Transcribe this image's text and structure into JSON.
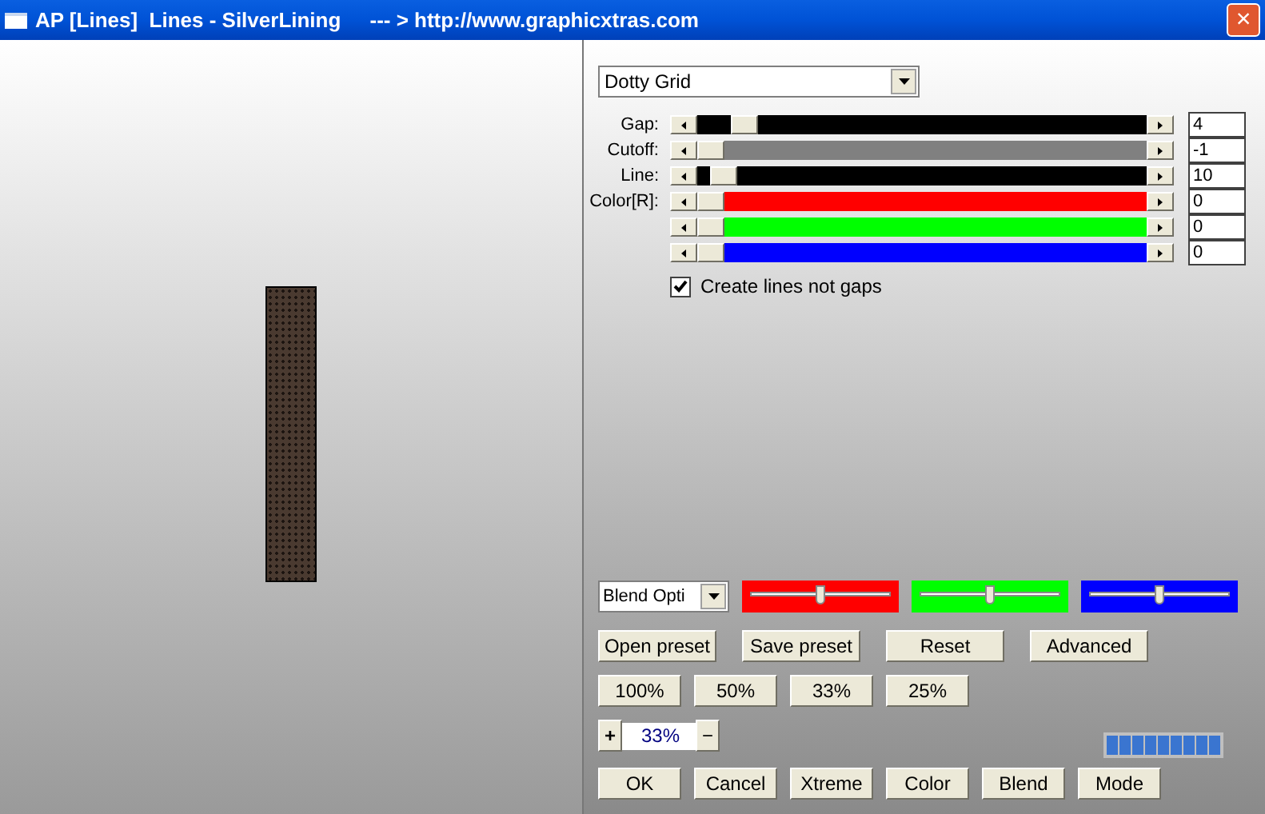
{
  "window": {
    "title": "AP [Lines]  Lines - SilverLining     --- > http://www.graphicxtras.com",
    "close": "×"
  },
  "preset_select": {
    "value": "Dotty Grid"
  },
  "sliders": [
    {
      "label": "Gap:",
      "color": "#000000",
      "level": 0.08,
      "value": "4"
    },
    {
      "label": "Cutoff:",
      "color": "#808080",
      "level": 0,
      "value": "-1"
    },
    {
      "label": "Line:",
      "color": "#000000",
      "level": 0.03,
      "value": "10"
    },
    {
      "label": "Color[R]:",
      "color": "#ff0000",
      "level": 0,
      "value": "0"
    },
    {
      "color": "#00ff00",
      "level": 0,
      "value": "0"
    },
    {
      "color": "#0000ff",
      "level": 0,
      "value": "0"
    }
  ],
  "checkbox": {
    "label": "Create lines not gaps",
    "checked": true
  },
  "blend_select": {
    "value": "Blend Opti"
  },
  "blend_sliders": [
    {
      "color": "#ff0000",
      "level": 0.5
    },
    {
      "color": "#00ff00",
      "level": 0.5
    },
    {
      "color": "#0000ff",
      "level": 0.5
    }
  ],
  "preset_buttons": [
    "Open preset",
    "Save preset",
    "Reset",
    "Advanced"
  ],
  "zoom_buttons": [
    "100%",
    "50%",
    "33%",
    "25%"
  ],
  "zoom": {
    "plus": "+",
    "value": "33%",
    "minus": "−"
  },
  "bottom_buttons": [
    "OK",
    "Cancel",
    "Xtreme",
    "Color",
    "Blend",
    "Mode"
  ]
}
